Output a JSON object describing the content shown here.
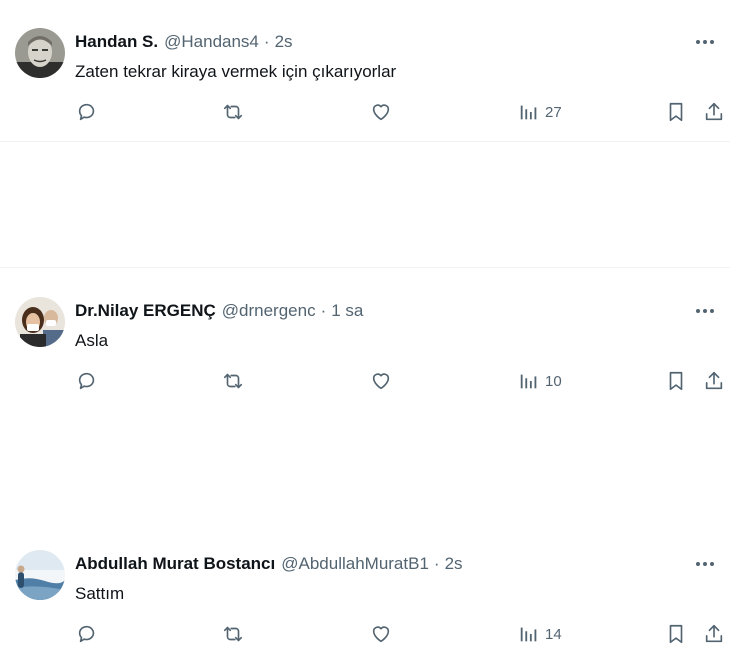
{
  "tweets": [
    {
      "name": "Handan S.",
      "handle": "@Handans4",
      "separator": "·",
      "time": "2s",
      "text": "Zaten tekrar kiraya vermek için çıkarıyorlar",
      "views": "27",
      "avatar_icon": "avatar-portrait-icon"
    },
    {
      "name": "Dr.Nilay ERGENÇ",
      "handle": "@drnergenc",
      "separator": "·",
      "time": "1 sa",
      "text": "Asla",
      "views": "10",
      "avatar_icon": "avatar-photo-icon"
    },
    {
      "name": "Abdullah Murat Bostancı",
      "handle": "@AbdullahMuratB1",
      "separator": "·",
      "time": "2s",
      "text": "Sattım",
      "views": "14",
      "avatar_icon": "avatar-landscape-icon"
    }
  ],
  "colors": {
    "text_primary": "#0f1419",
    "text_secondary": "#536471",
    "divider": "#eff3f4",
    "icon": "#536471"
  },
  "icons": [
    "reply-icon",
    "retweet-icon",
    "like-icon",
    "views-icon",
    "bookmark-icon",
    "share-icon",
    "more-icon"
  ]
}
